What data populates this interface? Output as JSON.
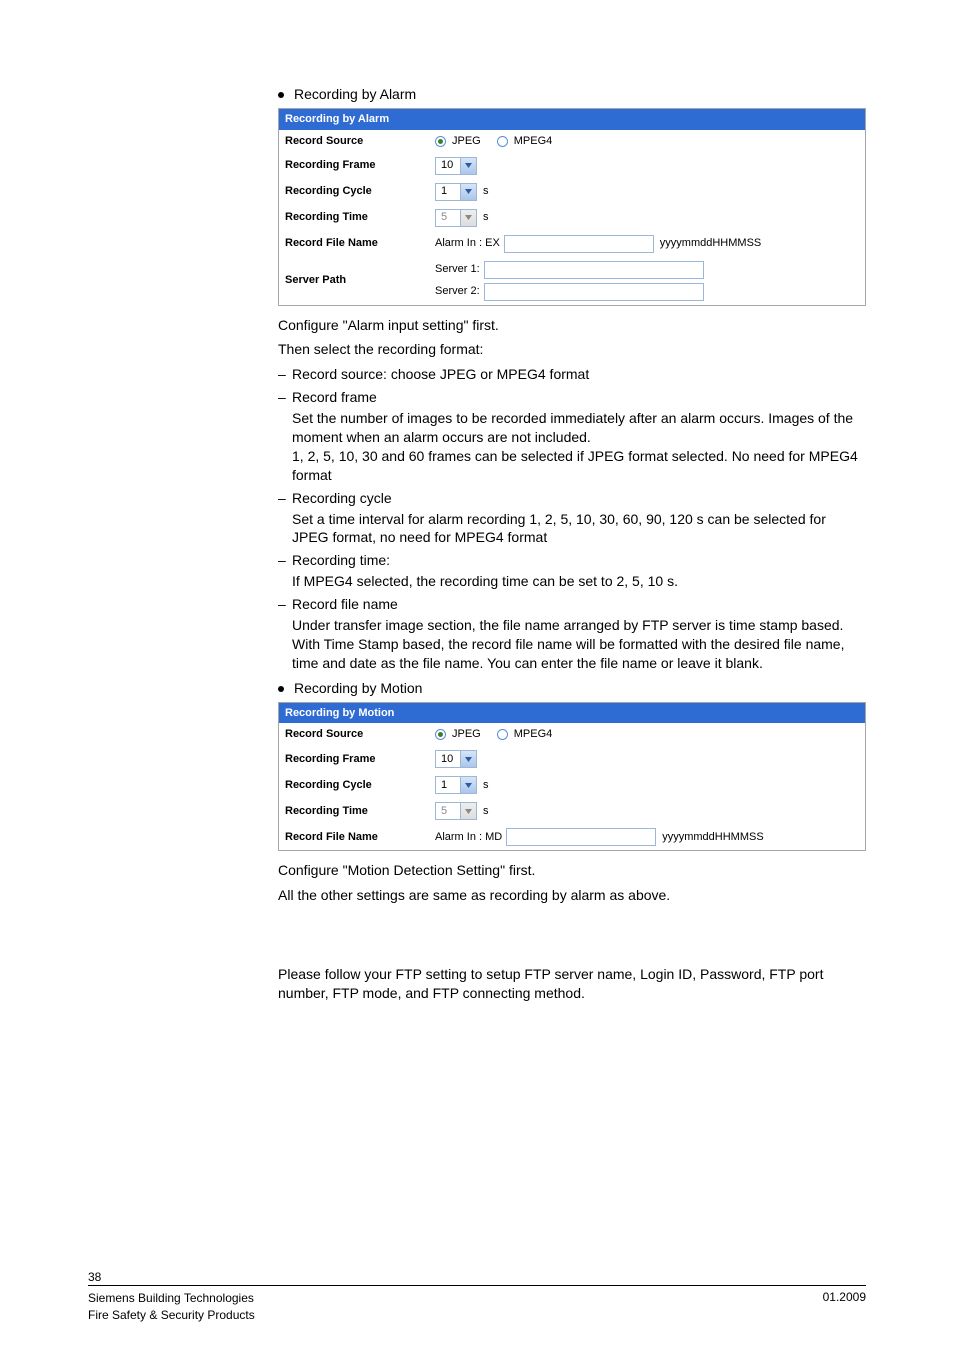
{
  "sections": {
    "alarm": {
      "bullet_title": "Recording by Alarm",
      "panel_header": "Recording by Alarm",
      "labels": {
        "record_source": "Record Source",
        "recording_frame": "Recording Frame",
        "recording_cycle": "Recording Cycle",
        "recording_time": "Recording Time",
        "record_file_name": "Record File Name",
        "server_path": "Server Path"
      },
      "radio": {
        "jpeg": "JPEG",
        "mpeg4": "MPEG4",
        "selected": "jpeg"
      },
      "frame_value": "10",
      "cycle_value": "1",
      "cycle_unit": "s",
      "time_value": "5",
      "time_unit": "s",
      "filename_prefix": "Alarm In : EX",
      "filename_input": "",
      "filename_suffix": "yyyymmddHHMMSS",
      "server1_label": "Server 1:",
      "server1_value": "",
      "server2_label": "Server 2:",
      "server2_value": "",
      "text": {
        "p1": "Configure \"Alarm input setting\" first.",
        "p2": "Then select the recording format:",
        "items": [
          {
            "title": "Record source: choose JPEG or MPEG4 format"
          },
          {
            "title": "Record frame",
            "body": "Set the number of images to be recorded immediately after an alarm occurs. Images of the moment when an alarm occurs are not included.\n1, 2, 5, 10, 30 and 60 frames can be selected if JPEG format selected. No need for MPEG4 format"
          },
          {
            "title": "Recording cycle",
            "body": "Set a time interval for alarm recording 1, 2, 5, 10, 30, 60, 90, 120 s can be selected for JPEG format, no need for MPEG4 format"
          },
          {
            "title": "Recording time:",
            "body": "If MPEG4 selected, the recording time can be set to 2, 5, 10 s."
          },
          {
            "title": "Record file name",
            "body": "Under transfer image section, the file name arranged by FTP server is time stamp based. With Time Stamp based, the record file name will be formatted with the desired file name, time and date as the file name. You can enter the file name or leave it blank."
          }
        ]
      }
    },
    "motion": {
      "bullet_title": "Recording by Motion",
      "panel_header": "Recording by Motion",
      "labels": {
        "record_source": "Record Source",
        "recording_frame": "Recording Frame",
        "recording_cycle": "Recording Cycle",
        "recording_time": "Recording Time",
        "record_file_name": "Record File Name"
      },
      "radio": {
        "jpeg": "JPEG",
        "mpeg4": "MPEG4",
        "selected": "jpeg"
      },
      "frame_value": "10",
      "cycle_value": "1",
      "cycle_unit": "s",
      "time_value": "5",
      "time_unit": "s",
      "filename_prefix": "Alarm In : MD",
      "filename_input": "",
      "filename_suffix": "yyyymmddHHMMSS",
      "text": {
        "p1": "Configure \"Motion Detection Setting\" first.",
        "p2": "All the other settings are same as recording by alarm as above."
      }
    },
    "ftp": {
      "text": "Please follow your FTP setting to setup FTP server name, Login ID, Password, FTP port number, FTP mode, and FTP connecting method."
    }
  },
  "footer": {
    "page_number": "38",
    "left_line1": "Siemens Building Technologies",
    "left_line2": "Fire Safety & Security Products",
    "right": "01.2009"
  }
}
